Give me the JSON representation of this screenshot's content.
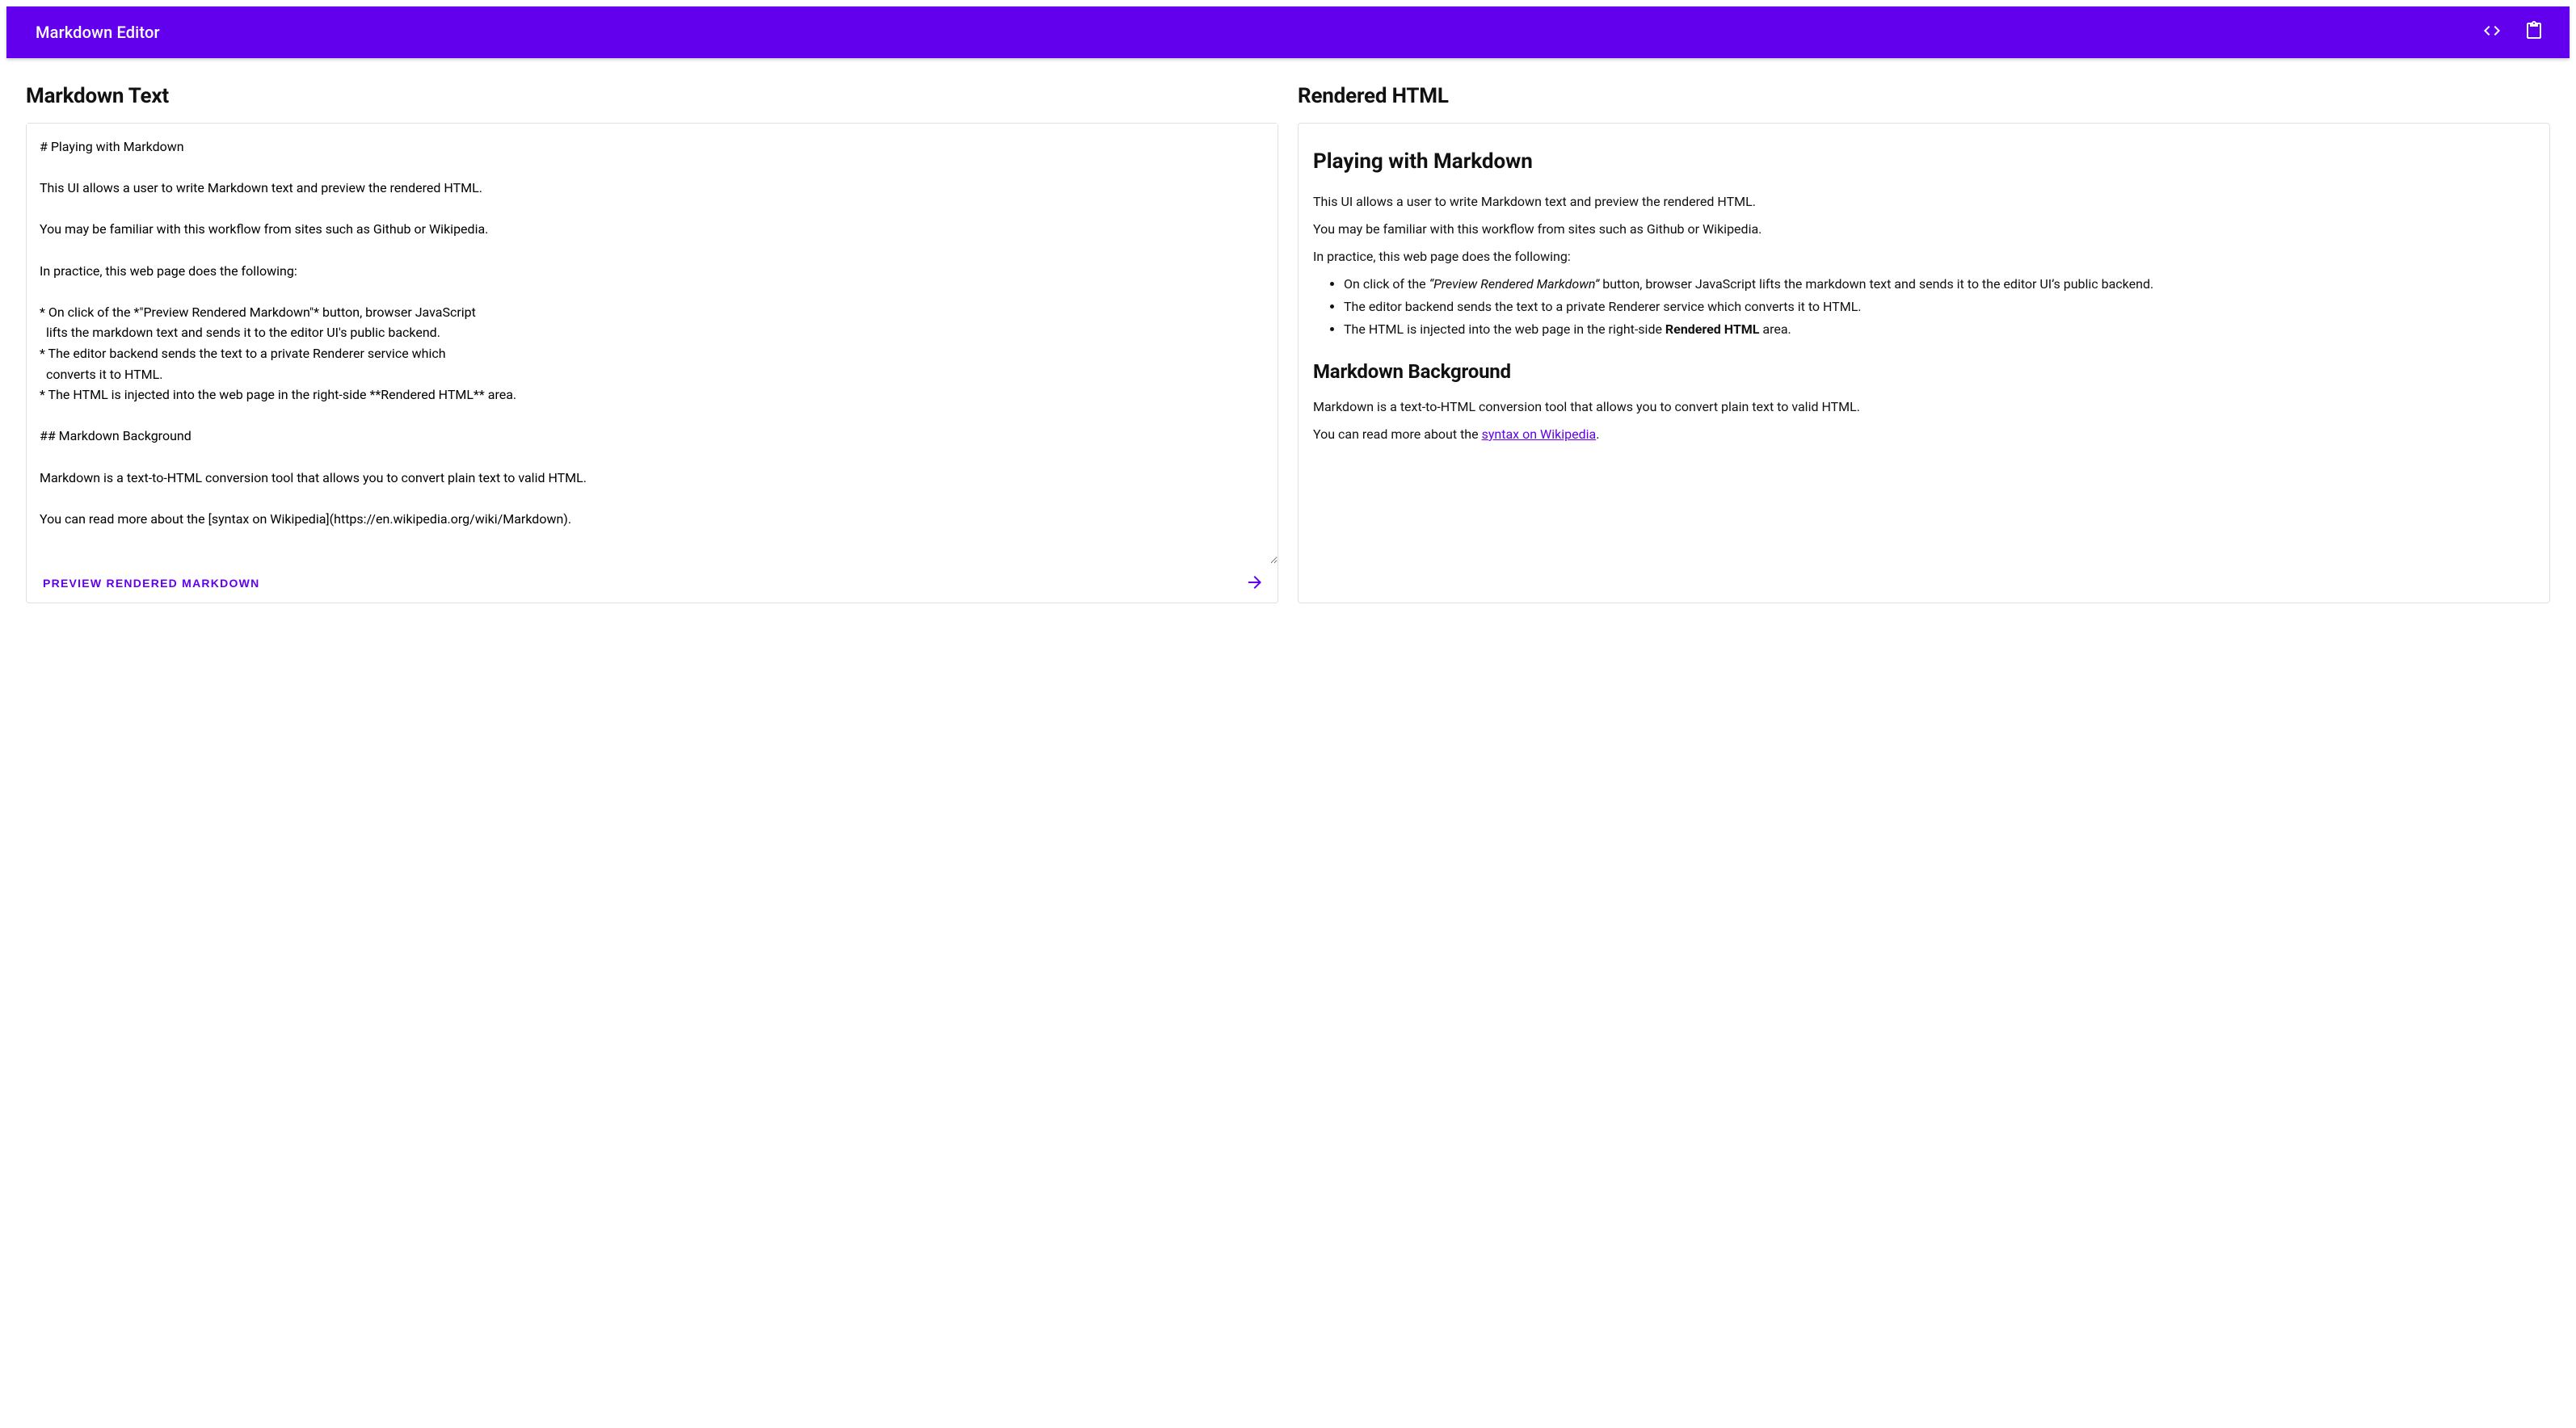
{
  "colors": {
    "accent": "#6200ee"
  },
  "header": {
    "title": "Markdown Editor",
    "actions": {
      "code_icon": "code-icon",
      "clipboard_icon": "clipboard-icon"
    }
  },
  "left": {
    "heading": "Markdown Text",
    "textarea_value": "# Playing with Markdown\n\nThis UI allows a user to write Markdown text and preview the rendered HTML.\n\nYou may be familiar with this workflow from sites such as Github or Wikipedia.\n\nIn practice, this web page does the following:\n\n* On click of the *\"Preview Rendered Markdown\"* button, browser JavaScript\n  lifts the markdown text and sends it to the editor UI's public backend.\n* The editor backend sends the text to a private Renderer service which\n  converts it to HTML.\n* The HTML is injected into the web page in the right-side **Rendered HTML** area.\n\n## Markdown Background\n\nMarkdown is a text-to-HTML conversion tool that allows you to convert plain text to valid HTML.\n\nYou can read more about the [syntax on Wikipedia](https://en.wikipedia.org/wiki/Markdown).",
    "preview_button_label": "Preview Rendered Markdown"
  },
  "right": {
    "heading": "Rendered HTML",
    "h1": "Playing with Markdown",
    "p1": "This UI allows a user to write Markdown text and preview the rendered HTML.",
    "p2": "You may be familiar with this workflow from sites such as Github or Wikipedia.",
    "p3": "In practice, this web page does the following:",
    "li1_pre": "On click of the ",
    "li1_em": "“Preview Rendered Markdown”",
    "li1_post": " button, browser JavaScript lifts the markdown text and sends it to the editor UI’s public backend.",
    "li2": "The editor backend sends the text to a private Renderer service which converts it to HTML.",
    "li3_pre": "The HTML is injected into the web page in the right-side ",
    "li3_strong": "Rendered HTML",
    "li3_post": " area.",
    "h2": "Markdown Background",
    "p4": "Markdown is a text-to-HTML conversion tool that allows you to convert plain text to valid HTML.",
    "p5_pre": "You can read more about the ",
    "p5_link": "syntax on Wikipedia",
    "p5_post": "."
  }
}
